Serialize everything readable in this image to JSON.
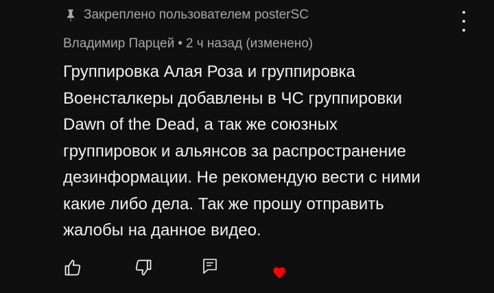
{
  "pinned": {
    "icon": "pin-icon",
    "text": "Закреплено пользователем posterSC"
  },
  "meta": {
    "author": "Владимир Парцей",
    "separator": "•",
    "time": "2 ч назад (изменено)"
  },
  "comment": {
    "lines": [
      "Группировка Алая Роза и группировка",
      "Военсталкеры добавлены в ЧС группировки",
      "Dawn of the Dead, а так же союзных",
      "группировок и альянсов за распространение",
      "дезинформации. Не рекомендую вести с ними",
      "какие либо дела. Так же прошу отправить",
      "жалобы на данное видео."
    ]
  },
  "actions": {
    "like_icon": "thumb-up-icon",
    "dislike_icon": "thumb-down-icon",
    "reply_icon": "comment-icon",
    "heart_icon": "heart-icon",
    "heart_color": "#ff0000"
  },
  "menu_icon": "more-vert-icon"
}
